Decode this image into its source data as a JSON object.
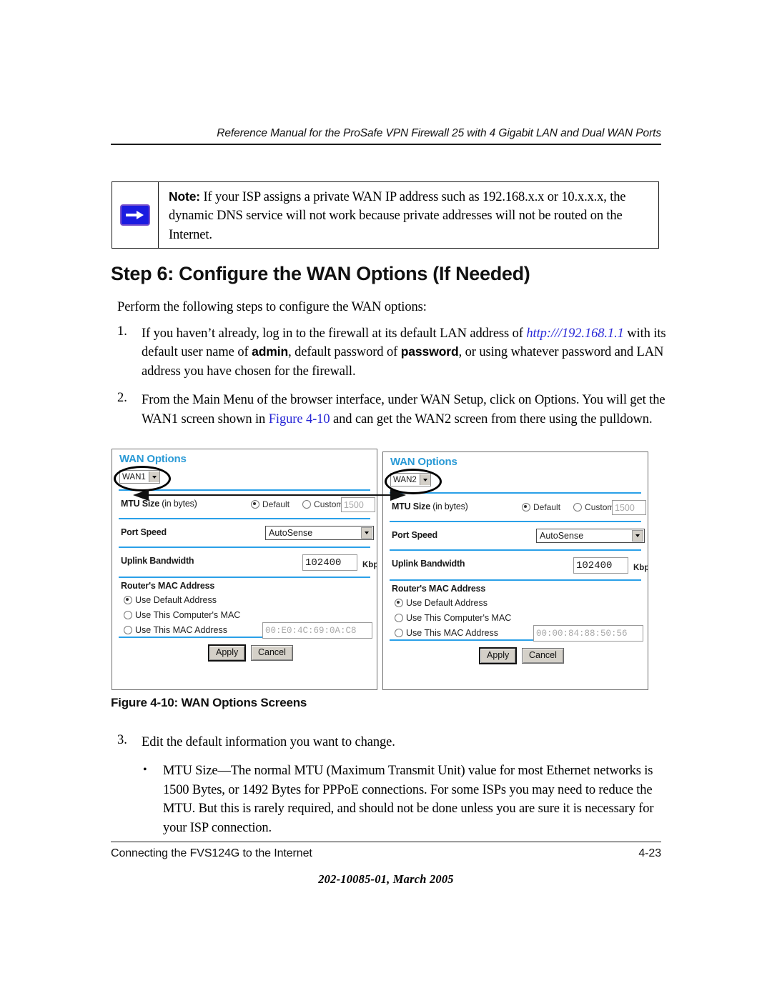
{
  "page": {
    "running_header": "Reference Manual for the ProSafe VPN Firewall 25 with 4 Gigabit LAN and Dual WAN Ports",
    "footer_left": "Connecting the FVS124G to the Internet",
    "footer_page": "4-23",
    "doc_id": "202-10085-01, March 2005"
  },
  "note": {
    "icon": "right-arrow-icon",
    "label": "Note:",
    "body": " If your ISP assigns a private WAN IP address such as 192.168.x.x or 10.x.x.x, the dynamic DNS service will not work because private addresses will not be routed on the Internet."
  },
  "heading": "Step 6: Configure the WAN Options (If Needed)",
  "intro": "Perform the following steps to configure the WAN options:",
  "steps_top": [
    {
      "number": "1.",
      "part1": "If you haven’t already, log in to the firewall at its default LAN address of ",
      "link": "http:///192.168.1.1",
      "part2": " with its default user name of ",
      "bold1": "admin",
      "part3": ", default password of ",
      "bold2": "password",
      "part4": ", or using whatever password and LAN address you have chosen for the firewall."
    },
    {
      "number": "2.",
      "part1": "From the Main Menu of the browser interface, under WAN Setup, click on Options. You will get the WAN1 screen shown in ",
      "link": "Figure 4-10",
      "part2": " and can get the WAN2 screen from there using the pulldown."
    }
  ],
  "figure": {
    "caption": "Figure 4-10:  WAN Options Screens",
    "arrow_name": "double-headed-arrow",
    "panels": [
      {
        "title": "WAN Options",
        "selector_value": "WAN1",
        "mtu": {
          "label": "MTU Size",
          "label_light": " (in bytes)",
          "default_option": "Default",
          "default_selected": true,
          "custom_option": "Custom",
          "custom_value": "1500"
        },
        "port_speed": {
          "label": "Port Speed",
          "value": "AutoSense"
        },
        "uplink": {
          "label": "Uplink Bandwidth",
          "value": "102400",
          "unit": "Kbps"
        },
        "mac": {
          "title": "Router's MAC Address",
          "opt1": "Use Default Address",
          "opt2": "Use This Computer's MAC",
          "opt3": "Use This MAC Address",
          "selected": "opt1",
          "mac_value": "00:E0:4C:69:0A:C8"
        },
        "buttons": {
          "apply": "Apply",
          "cancel": "Cancel"
        }
      },
      {
        "title": "WAN Options",
        "selector_value": "WAN2",
        "mtu": {
          "label": "MTU Size",
          "label_light": " (in bytes)",
          "default_option": "Default",
          "default_selected": true,
          "custom_option": "Custom",
          "custom_value": "1500"
        },
        "port_speed": {
          "label": "Port Speed",
          "value": "AutoSense"
        },
        "uplink": {
          "label": "Uplink Bandwidth",
          "value": "102400",
          "unit": "Kbps"
        },
        "mac": {
          "title": "Router's MAC Address",
          "opt1": "Use Default Address",
          "opt2": "Use This Computer's MAC",
          "opt3": "Use This MAC Address",
          "selected": "opt1",
          "mac_value": "00:00:84:88:50:56"
        },
        "buttons": {
          "apply": "Apply",
          "cancel": "Cancel"
        }
      }
    ]
  },
  "steps_bottom": [
    {
      "number": "3.",
      "text": "Edit the default information you want to change."
    }
  ],
  "bullets": [
    {
      "marker": "•",
      "text": "MTU Size—The normal MTU (Maximum Transmit Unit) value for most Ethernet networks is 1500 Bytes, or 1492 Bytes for PPPoE connections. For some ISPs you may need to reduce the MTU. But this is rarely required, and should not be done unless you are sure it is necessary for your ISP connection."
    }
  ],
  "colors": {
    "link": "#2727d6",
    "panel_title": "#2a9ad6",
    "panel_rule": "#2aa0e8",
    "note_icon": "#1b1be0"
  }
}
